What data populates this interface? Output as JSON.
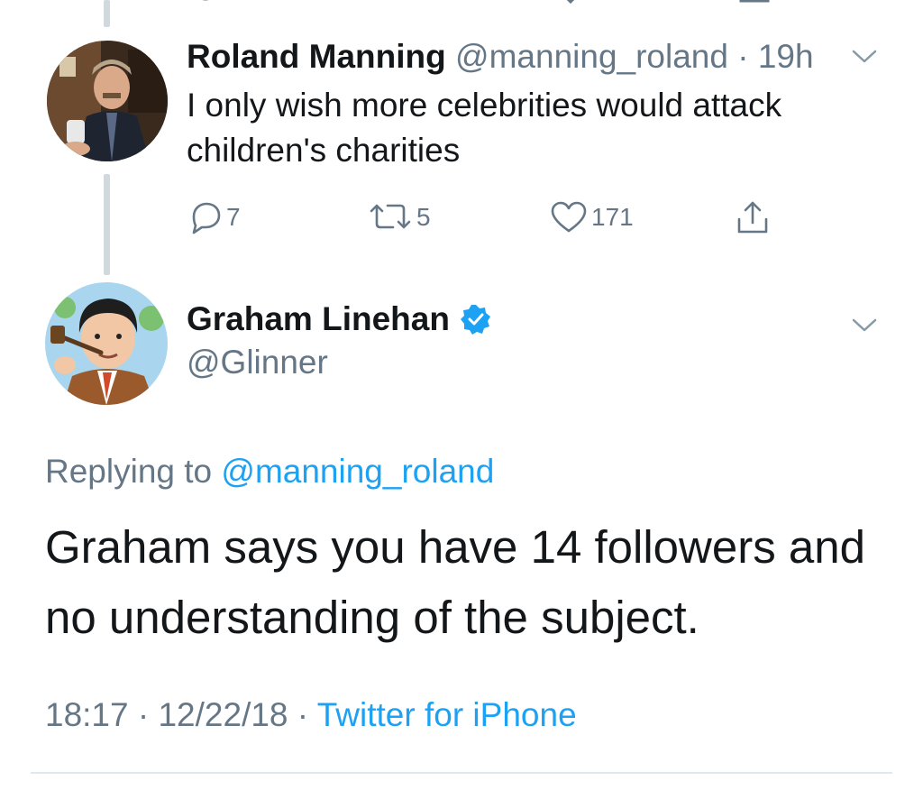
{
  "tweet_1": {
    "name": "Roland Manning",
    "handle": "@manning_roland",
    "separator": "·",
    "time": "19h",
    "text": "I only wish more celebrities would attack children's charities",
    "reply_count": "7",
    "retweet_count": "5",
    "like_count": "171",
    "icons": [
      "reply-icon",
      "retweet-icon",
      "like-icon",
      "share-icon",
      "chevron-down-icon"
    ]
  },
  "tweet_2": {
    "name": "Graham Linehan",
    "handle": "@Glinner",
    "verified": true,
    "replying_prefix": "Replying to ",
    "replying_to": "@manning_roland",
    "text": "Graham says you have 14 followers and no understanding of the subject.",
    "time": "18:17",
    "separator_1": " · ",
    "date": "12/22/18",
    "separator_2": " · ",
    "source": "Twitter for iPhone",
    "icons": [
      "verified-badge-icon",
      "chevron-down-icon"
    ]
  },
  "colors": {
    "text_primary": "#14171a",
    "text_secondary": "#657786",
    "link": "#1da1f2",
    "thread_line": "#cfd9de",
    "divider": "#e1e8ed"
  }
}
